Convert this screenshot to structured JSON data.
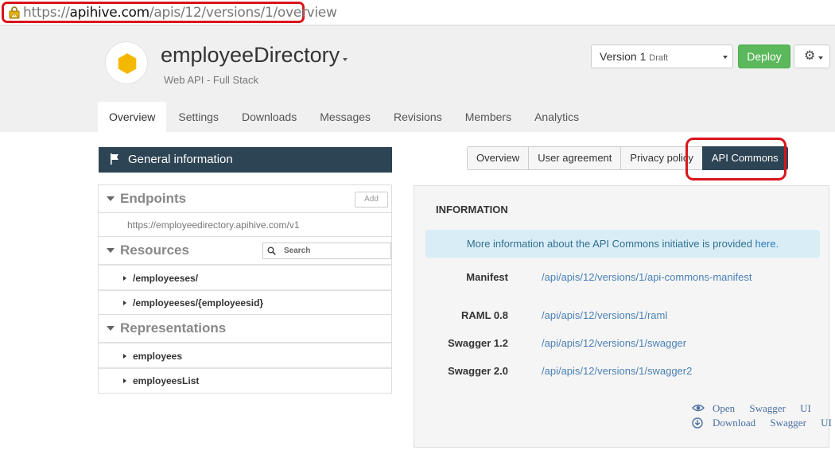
{
  "browser": {
    "url_prefix": "https://",
    "url_host": "apihive.com",
    "url_path": "/apis/12/versions/1/overview"
  },
  "header": {
    "api_name": "employeeDirectory",
    "api_type": "Web API - Full Stack",
    "version_label": "Version 1",
    "version_status": "Draft",
    "deploy_label": "Deploy",
    "tabs": [
      "Overview",
      "Settings",
      "Downloads",
      "Messages",
      "Revisions",
      "Members",
      "Analytics"
    ],
    "active_tab": "Overview"
  },
  "left": {
    "general_info_title": "General information",
    "endpoints": {
      "title": "Endpoints",
      "add_label": "Add",
      "url": "https://employeedirectory.apihive.com/v1"
    },
    "resources": {
      "title": "Resources",
      "search_placeholder": "Search",
      "items": [
        "/employeeses/",
        "/employeeses/{employeesid}"
      ]
    },
    "representations": {
      "title": "Representations",
      "items": [
        "employees",
        "employeesList"
      ]
    }
  },
  "right": {
    "subtabs": [
      "Overview",
      "User agreement",
      "Privacy policy",
      "API Commons"
    ],
    "active_subtab": "API Commons",
    "info_heading": "INFORMATION",
    "alert_text": "More information about the API Commons initiative is provided ",
    "alert_link": "here.",
    "definitions": [
      {
        "label": "Manifest",
        "value": "/api/apis/12/versions/1/api-commons-manifest"
      },
      {
        "label": "RAML 0.8",
        "value": "/api/apis/12/versions/1/raml"
      },
      {
        "label": "Swagger 1.2",
        "value": "/api/apis/12/versions/1/swagger"
      },
      {
        "label": "Swagger 2.0",
        "value": "/api/apis/12/versions/1/swagger2"
      }
    ],
    "swagger_open": "Open Swagger UI",
    "swagger_download": "Download Swagger UI"
  },
  "colors": {
    "header_bg": "#f0f0f0",
    "dark_navy": "#2d4454",
    "deploy_green": "#5cb85c",
    "highlight_red": "#d9151b",
    "logo_yellow": "#f5b800",
    "link_blue": "#4a81b5",
    "alert_bg": "#d9edf7"
  }
}
